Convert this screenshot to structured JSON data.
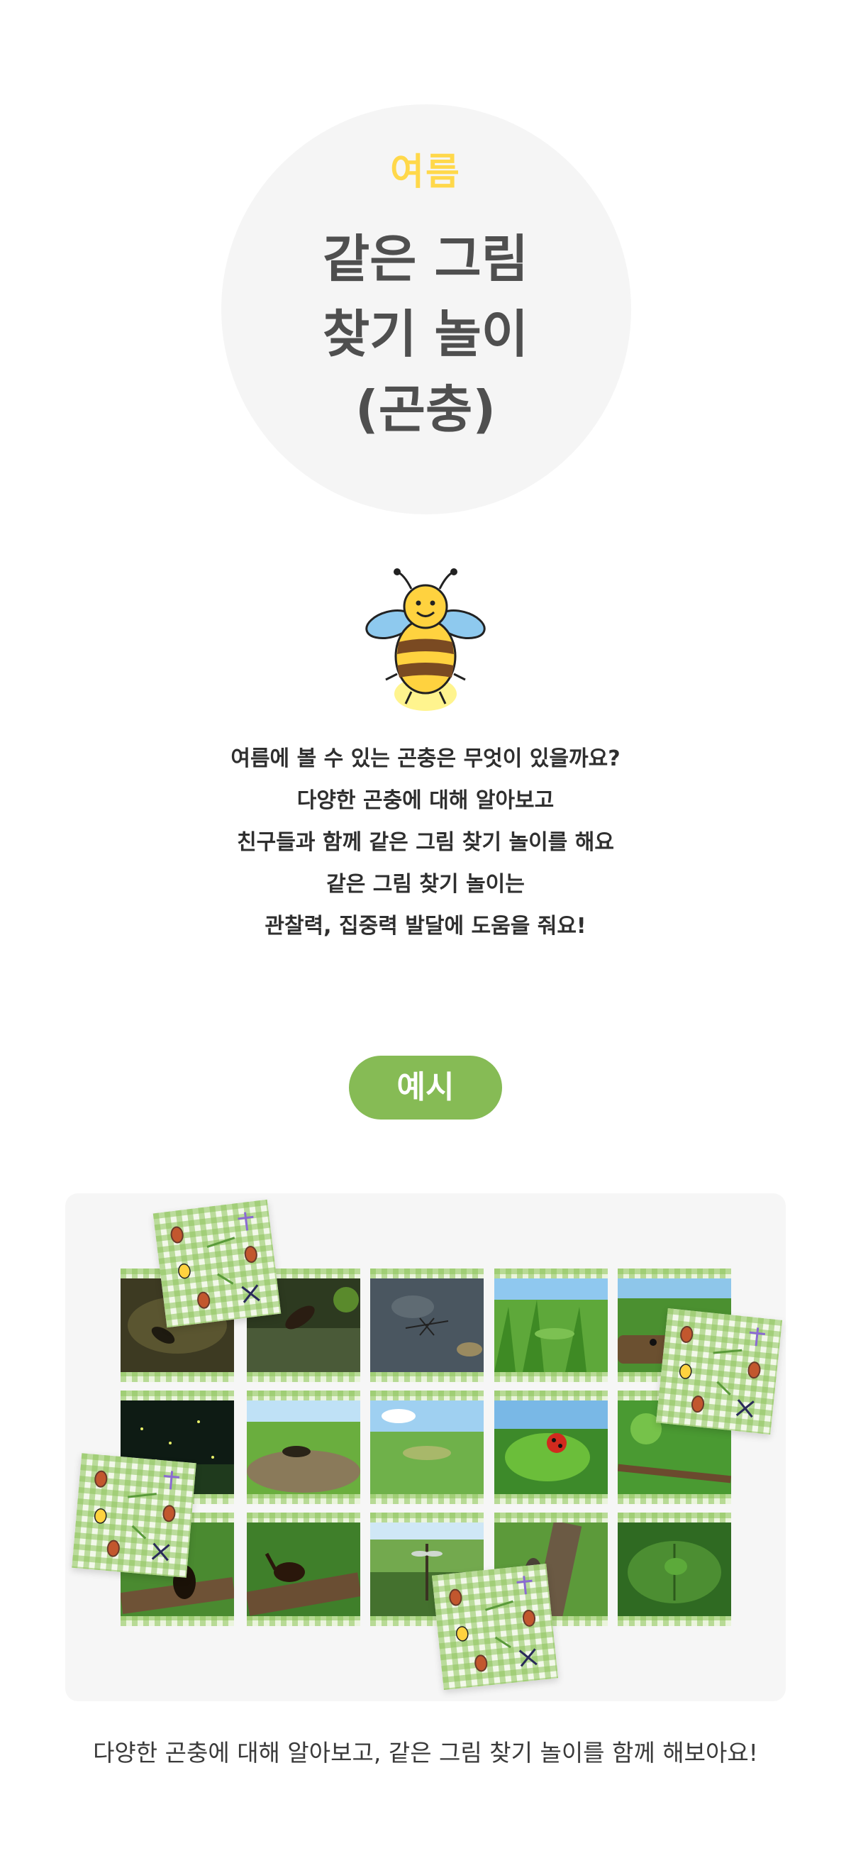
{
  "hero": {
    "season": "여름",
    "title_lines": [
      "같은 그림",
      "찾기 놀이",
      "(곤충)"
    ]
  },
  "description": [
    "여름에 볼 수 있는 곤충은 무엇이 있을까요?",
    "다양한 곤충에 대해 알아보고",
    "친구들과 함께 같은 그림 찾기 놀이를 해요",
    "같은 그림 찾기 놀이는",
    "관찰력, 집중력 발달에 도움을 줘요!"
  ],
  "example_label": "예시",
  "cards": [
    "water-beetle",
    "diving-beetle",
    "water-strider",
    "katydid",
    "ant-on-log",
    "fireflies",
    "cricket",
    "grasshopper",
    "ladybug",
    "bug-on-branch",
    "stag-beetle",
    "rhinoceros-beetle",
    "dragonfly",
    "cicada",
    "stink-bug"
  ],
  "caption": "다양한 곤충에 대해 알아보고, 같은 그림 찾기 놀이를 함께 해보아요!",
  "colors": {
    "accent_green": "#86bb55",
    "season_yellow": "#ffd84a",
    "title_gray": "#4f4f4f"
  }
}
